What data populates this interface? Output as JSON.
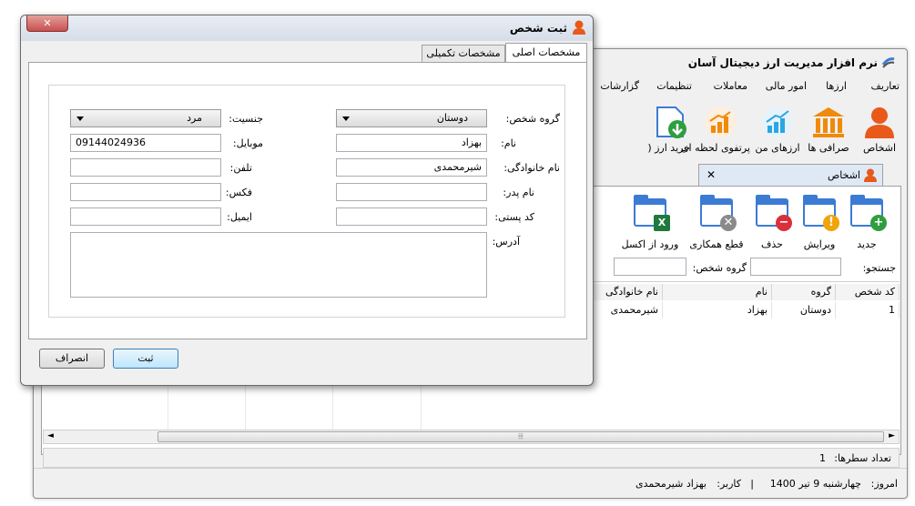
{
  "main": {
    "title": "نرم افزار مدیریت ارز دیجیتال آسان",
    "menu": [
      "تعاریف",
      "ارزها",
      "امور مالی",
      "معاملات",
      "تنظیمات",
      "گزارشات"
    ],
    "toolbar": [
      {
        "label": "اشخاص",
        "icon": "person-icon"
      },
      {
        "label": "صرافی ها",
        "icon": "bank-icon"
      },
      {
        "label": "ارزهای من",
        "icon": "chart-up-icon"
      },
      {
        "label": "پرتفوی لحظه ای",
        "icon": "chart-bar-icon"
      },
      {
        "label": "خرید ارز (2",
        "icon": "download-icon"
      }
    ],
    "tab_label": "اشخاص",
    "actions": [
      {
        "label": "جدید",
        "badge": "+",
        "color": "#2e9e3e"
      },
      {
        "label": "ویرایش",
        "badge": "!",
        "color": "#f0a30a"
      },
      {
        "label": "حذف",
        "badge": "−",
        "color": "#d9303a"
      },
      {
        "label": "قطع همکاری",
        "badge": "✕",
        "color": "#8a8a8a"
      },
      {
        "label": "ورود از اکسل",
        "badge": "X",
        "color": "#1e7a3c"
      }
    ],
    "search_label": "جستجو:",
    "group_label": "گروه شخص:",
    "grid": {
      "headers": [
        "کد شخص",
        "گروه",
        "نام",
        "نام خانوادگی"
      ],
      "rows": [
        [
          "1",
          "دوستان",
          "بهزاد",
          "شیرمحمدی"
        ]
      ]
    },
    "row_count_label": "تعداد سطرها:",
    "row_count": "1",
    "status_today_label": "امروز:",
    "status_today": "چهارشنبه 9 تیر 1400",
    "status_user_label": "کاربر:",
    "status_user": "بهزاد شیرمحمدی",
    "status_sep": "|"
  },
  "dialog": {
    "title": "ثبت شخص",
    "tabs": [
      "مشخصات اصلی",
      "مشخصات تکمیلی"
    ],
    "fields": {
      "group": {
        "label": "گروه شخص:",
        "value": "دوستان"
      },
      "first_name": {
        "label": "نام:",
        "value": "بهزاد"
      },
      "last_name": {
        "label": "نام خانوادگی:",
        "value": "شیرمحمدی"
      },
      "father_name": {
        "label": "نام پدر:",
        "value": ""
      },
      "postal_code": {
        "label": "کد پستی:",
        "value": ""
      },
      "address": {
        "label": "آدرس:",
        "value": ""
      },
      "gender": {
        "label": "جنسیت:",
        "value": "مرد"
      },
      "mobile": {
        "label": "موبایل:",
        "value": "09144024936"
      },
      "phone": {
        "label": "تلفن:",
        "value": ""
      },
      "fax": {
        "label": "فکس:",
        "value": ""
      },
      "email": {
        "label": "ایمیل:",
        "value": ""
      }
    },
    "submit_label": "ثبت",
    "cancel_label": "انصراف",
    "close_glyph": "✕"
  },
  "colors": {
    "accent": "#3b7bd4",
    "close_red": "#c75050",
    "person": "#e8591a"
  }
}
